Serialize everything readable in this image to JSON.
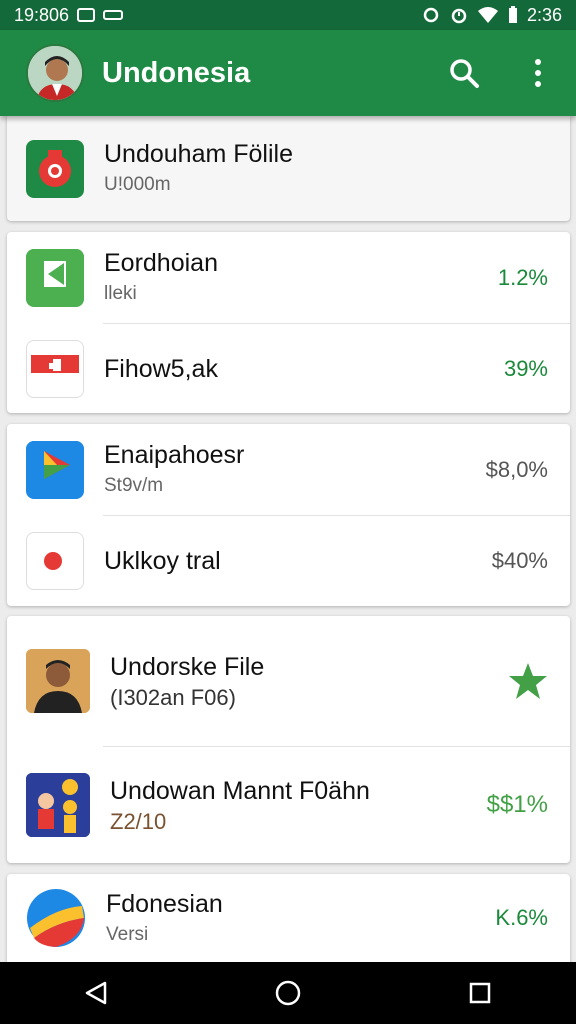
{
  "status_bar": {
    "time_left": "19:806",
    "time_right": "2:36"
  },
  "app_bar": {
    "title": "Undonesia",
    "avatar_icon": "person-avatar",
    "search_icon": "search-icon",
    "menu_icon": "more-vertical-icon"
  },
  "items": [
    {
      "title": "Undouham Fölile",
      "sub": "U!000m",
      "value": "",
      "icon": "red-badge-icon",
      "icon_bg": "#1e8a45"
    },
    {
      "title": "Eordhoian",
      "sub": "lleki",
      "value": "1.2%",
      "icon": "green-chat-icon",
      "icon_bg": "#4caf50"
    },
    {
      "title": "Fihow5,ak",
      "sub": "",
      "value": "39%",
      "icon": "red-flag-icon",
      "icon_bg": "#ffffff"
    },
    {
      "title": "Enaipahoesr",
      "sub": "St9v/m",
      "value": "$8,0%",
      "icon": "blue-play-icon",
      "icon_bg": "#1e88e5"
    },
    {
      "title": "Uklkoy tral",
      "sub": "",
      "value": "$40%",
      "icon": "red-dot-flag-icon",
      "icon_bg": "#ffffff"
    },
    {
      "title": "Undorske File",
      "sub": "(I302an F06)",
      "value": "",
      "icon": "man-photo-icon",
      "icon_bg": "#d9a45a"
    },
    {
      "title": "Undowan Mannt F0ähn",
      "sub": "Z2/10",
      "value": "$$1%",
      "icon": "illustration-icon",
      "icon_bg": "#2b3f9a"
    },
    {
      "title": "Fdonesian",
      "sub": "Versi",
      "value": "K.6%",
      "icon": "globe-icon",
      "icon_bg": "#ffffff"
    }
  ],
  "colors": {
    "status_bar": "#14693a",
    "app_bar": "#1e8a45",
    "value_green": "#1a8a3a",
    "star_green": "#43a047"
  },
  "nav": {
    "back": "back-icon",
    "home": "home-icon",
    "recents": "recents-icon"
  }
}
